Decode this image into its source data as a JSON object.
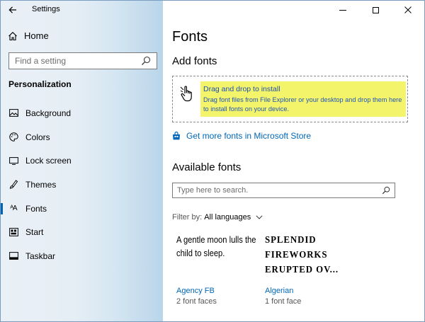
{
  "window": {
    "app_title": "Settings",
    "controls": {
      "minimize": "—",
      "maximize": "☐",
      "close": "✕"
    }
  },
  "sidebar": {
    "back_label": "←",
    "home_label": "Home",
    "search_placeholder": "Find a setting",
    "section_title": "Personalization",
    "items": [
      {
        "label": "Background",
        "icon": "background-icon"
      },
      {
        "label": "Colors",
        "icon": "palette-icon"
      },
      {
        "label": "Lock screen",
        "icon": "lock-screen-icon"
      },
      {
        "label": "Themes",
        "icon": "themes-icon"
      },
      {
        "label": "Fonts",
        "icon": "fonts-icon",
        "active": true
      },
      {
        "label": "Start",
        "icon": "start-icon"
      },
      {
        "label": "Taskbar",
        "icon": "taskbar-icon"
      }
    ]
  },
  "main": {
    "title": "Fonts",
    "add_fonts_heading": "Add fonts",
    "drop_title": "Drag and drop to install",
    "drop_description": "Drag font files from File Explorer or your desktop and drop them here to install fonts on your device.",
    "store_link": "Get more fonts in Microsoft Store",
    "available_heading": "Available fonts",
    "font_search_placeholder": "Type here to search.",
    "filter_label": "Filter by:",
    "filter_value": "All languages",
    "fonts": [
      {
        "preview": "A gentle moon lulls the child to sleep.",
        "name": "Agency FB",
        "faces": "2 font faces"
      },
      {
        "preview": "SPLENDID FIREWORKS ERUPTED OV...",
        "name": "Algerian",
        "faces": "1 font face"
      }
    ]
  },
  "colors": {
    "accent": "#0067b8",
    "highlight": "#f4f46b",
    "active_indicator": "#0063b1"
  }
}
